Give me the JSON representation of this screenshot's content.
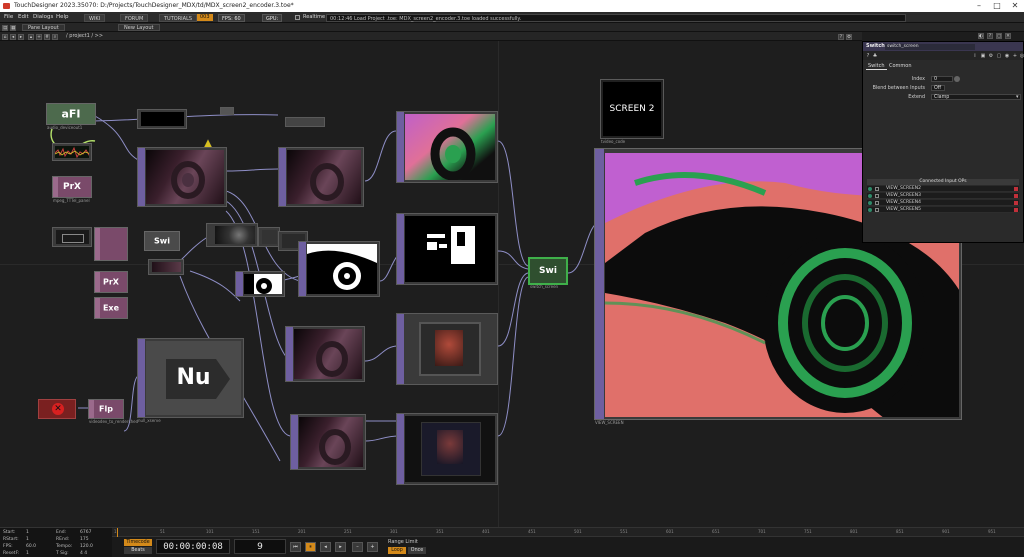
{
  "window": {
    "title": "TouchDesigner 2023.35070: D:/Projects/TouchDesigner_MDX/td/MDX_screen2_encoder.3.toe*",
    "controls": [
      "–",
      "□",
      "✕"
    ]
  },
  "menubar": {
    "items": [
      "File",
      "Edit",
      "Dialogs",
      "Help"
    ],
    "buttons": [
      "WIKI",
      "FORUM",
      "TUTORIALS"
    ],
    "badge": "003",
    "fps_label": "FPS:",
    "fps_value": "60",
    "gpu_label": "GPU:",
    "realtime_label": "Realtime",
    "status": "00:12:46 Load Project .toe: MDX_screen2_encoder.3.toe loaded successfully."
  },
  "panel_tabs": [
    "Pane Layout",
    "New Layout"
  ],
  "pathbar": {
    "path": "/ project1 / >>"
  },
  "nodes": {
    "afi": "aFI",
    "afi_label": "audio_deviceout1",
    "prx1": "PrX",
    "prx1_label": "mpeg_TTTel_panel",
    "prx2": "PrX",
    "exe": "Exe",
    "swi_small": "Swi",
    "swi_main": "Swi",
    "swi_main_label": "switch_screen",
    "flp": "Flp",
    "flp_label": "videodev_to_rendershed",
    "screen2_text": "SCREEN 2",
    "screen2_label": "tvideo_code",
    "null_text": "Nu",
    "null_label": "null_xserve",
    "out_label": "VIEW_SCREEN"
  },
  "params": {
    "op_type": "Switch",
    "op_name": "switch_screen",
    "tabs": [
      "Switch",
      "Common"
    ],
    "index_label": "Index",
    "index_value": "0",
    "blend_label": "Blend between Inputs",
    "blend_value": "Off",
    "extend_label": "Extend",
    "extend_value": "Clamp",
    "table_header": "Connected Input OPs",
    "inputs": [
      "VIEW_SCREEN2",
      "VIEW_SCREEN3",
      "VIEW_SCREEN4",
      "VIEW_SCREEN5"
    ]
  },
  "stats": {
    "start_label": "Start:",
    "start_value": "1",
    "end_label": "End:",
    "end_value": "6767",
    "rstart_label": "RStart:",
    "rstart_value": "1",
    "rend_label": "REnd:",
    "rend_value": "175",
    "fps_label": "FPS:",
    "fps_value": "60.0",
    "tempo_label": "Tempo:",
    "tempo_value": "120.0",
    "resetf_label": "ResetF:",
    "resetf_value": "1",
    "tsig_label": "T Sig:",
    "tsig_value": "4    4"
  },
  "timeline": {
    "ticks": [
      "1",
      "51",
      "101",
      "151",
      "201",
      "251",
      "301",
      "351",
      "401",
      "451",
      "501",
      "551",
      "601",
      "651",
      "701",
      "751",
      "801",
      "851",
      "901",
      "951"
    ],
    "timecode_btn": "Timecode",
    "beats_btn": "Beats",
    "timecode": "00:00:00:08",
    "frame": "9",
    "range_label": "Range Limit",
    "loop_btn": "Loop",
    "once_btn": "Once"
  },
  "colors": {
    "accent": "#6e5fa0",
    "orange": "#d48a1a",
    "green_wire": "#7fd35a",
    "wire": "#b4b4ff"
  }
}
